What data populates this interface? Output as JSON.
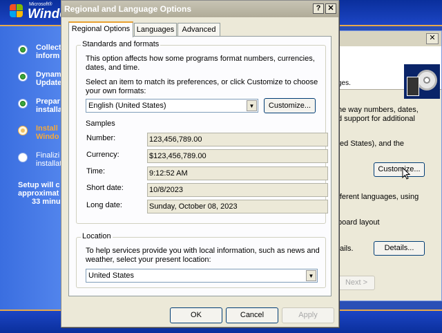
{
  "setup": {
    "logo_microsoft": "Microsoft®",
    "logo_windows": "Windo",
    "steps": [
      {
        "line1": "Collect",
        "line2": "inform",
        "state": "done"
      },
      {
        "line1": "Dynam",
        "line2": "Update",
        "state": "done"
      },
      {
        "line1": "Prepar",
        "line2": "installa",
        "state": "done"
      },
      {
        "line1": "Install",
        "line2": "Windo",
        "state": "current"
      },
      {
        "line1": "Finalizi",
        "line2": "installat",
        "state": "pending"
      }
    ],
    "remaining": [
      "Setup will c",
      "approximat",
      "33 minu"
    ]
  },
  "back_dialog": {
    "header_fragment": "ges.",
    "lines": [
      "he way numbers, dates,",
      "d support for additional",
      "ted States), and the",
      "fferent languages, using",
      "board layout",
      "tails."
    ],
    "customize_button": "Customize...",
    "details_button": "Details...",
    "next_button": "Next >",
    "close_glyph": "✕"
  },
  "dialog": {
    "title": "Regional and Language Options",
    "help_glyph": "?",
    "close_glyph": "✕",
    "tabs": [
      {
        "label": "Regional Options",
        "active": true
      },
      {
        "label": "Languages",
        "active": false
      },
      {
        "label": "Advanced",
        "active": false
      }
    ],
    "standards": {
      "group_title": "Standards and formats",
      "description_line1": "This option affects how some programs format numbers, currencies,",
      "description_line2": "dates, and time.",
      "select_line1": "Select an item to match its preferences, or click Customize to choose",
      "select_line2": "your own formats:",
      "format_value": "English (United States)",
      "customize_button": "Customize...",
      "samples_label": "Samples",
      "samples": [
        {
          "label": "Number:",
          "value": "123,456,789.00"
        },
        {
          "label": "Currency:",
          "value": "$123,456,789.00"
        },
        {
          "label": "Time:",
          "value": "9:12:52 AM"
        },
        {
          "label": "Short date:",
          "value": "10/8/2023"
        },
        {
          "label": "Long date:",
          "value": "Sunday, October 08, 2023"
        }
      ]
    },
    "location": {
      "group_title": "Location",
      "description_line1": "To help services provide you with local information, such as news and",
      "description_line2": "weather, select your present location:",
      "value": "United States"
    },
    "buttons": {
      "ok": "OK",
      "cancel": "Cancel",
      "apply": "Apply"
    }
  }
}
